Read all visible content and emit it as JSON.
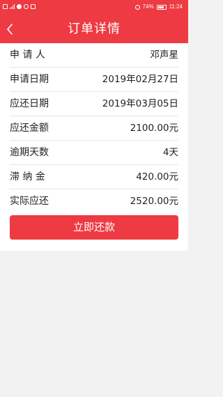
{
  "status_bar": {
    "battery": "74%",
    "time": "11:24"
  },
  "header": {
    "title": "订单详情"
  },
  "details": [
    {
      "label": "申 请 人",
      "value": "邓声星"
    },
    {
      "label": "申请日期",
      "value": "2019年02月27日"
    },
    {
      "label": "应还日期",
      "value": "2019年03月05日"
    },
    {
      "label": "应还金额",
      "value": "2100.00元"
    },
    {
      "label": "逾期天数",
      "value": "4天"
    },
    {
      "label": "滞 纳 金",
      "value": "420.00元"
    },
    {
      "label": "实际应还",
      "value": "2520.00元"
    }
  ],
  "actions": {
    "repay_label": "立即还款"
  },
  "colors": {
    "accent": "#ee3a43",
    "background": "#f2f2f2"
  }
}
